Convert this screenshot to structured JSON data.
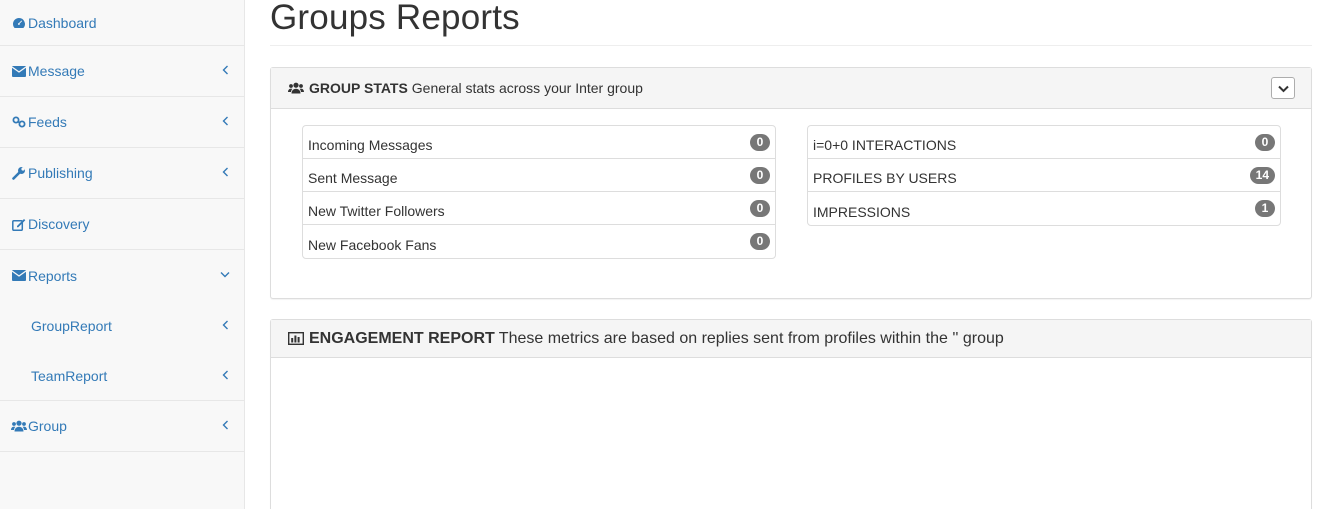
{
  "sidebar": {
    "items": [
      {
        "label": "Dashboard",
        "icon": "dashboard-icon"
      },
      {
        "label": "Message",
        "icon": "envelope-icon"
      },
      {
        "label": "Feeds",
        "icon": "link-icon"
      },
      {
        "label": "Publishing",
        "icon": "wrench-icon"
      },
      {
        "label": "Discovery",
        "icon": "edit-icon"
      },
      {
        "label": "Reports",
        "icon": "envelope-icon"
      },
      {
        "label": "GroupReport"
      },
      {
        "label": "TeamReport"
      },
      {
        "label": "Group",
        "icon": "users-icon"
      }
    ]
  },
  "page": {
    "title": "Groups Reports"
  },
  "group_stats": {
    "title": "GROUP STATS",
    "subtitle": "General stats across your Inter group",
    "left": [
      {
        "label": "Incoming Messages",
        "count": "0"
      },
      {
        "label": "Sent Message",
        "count": "0"
      },
      {
        "label": "New Twitter Followers",
        "count": "0"
      },
      {
        "label": "New Facebook Fans",
        "count": "0"
      }
    ],
    "right": [
      {
        "label": "i=0+0 INTERACTIONS",
        "count": "0"
      },
      {
        "label": "PROFILES BY USERS",
        "count": "14"
      },
      {
        "label": "IMPRESSIONS",
        "count": "1"
      }
    ]
  },
  "engagement": {
    "title": "ENGAGEMENT REPORT",
    "subtitle": "These metrics are based on replies sent from profiles within the '' group"
  },
  "colors": {
    "link": "#337ab7",
    "badge": "#777777",
    "sidebar_bg": "#f8f8f8"
  }
}
